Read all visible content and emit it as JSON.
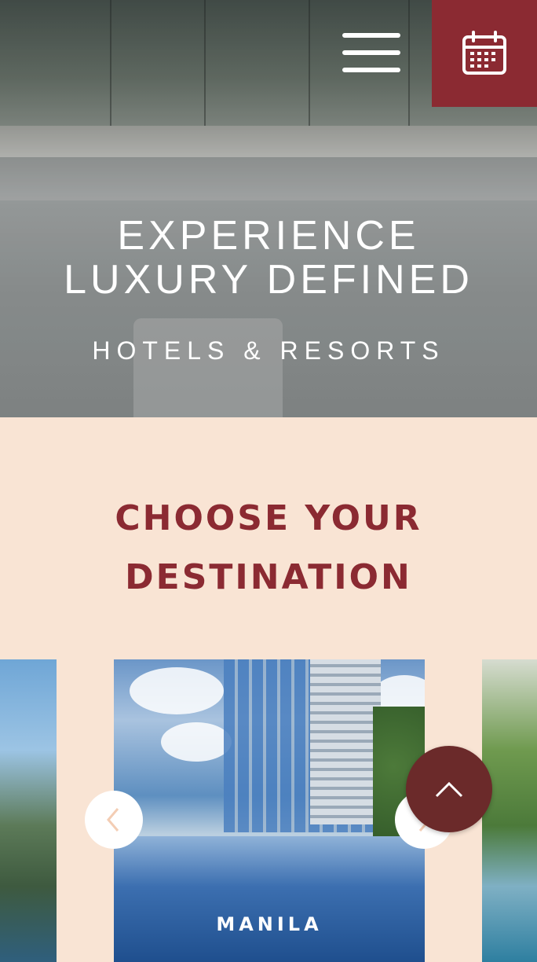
{
  "hero": {
    "title_line1": "EXPERIENCE",
    "title_line2": "LUXURY DEFINED",
    "subtitle": "HOTELS & RESORTS"
  },
  "header": {
    "menu_icon": "hamburger-menu-icon",
    "calendar_icon": "calendar-icon",
    "accent_color": "#8b2a32"
  },
  "destinations": {
    "title_line1": "CHOOSE YOUR",
    "title_line2": "DESTINATION",
    "cards": [
      {
        "caption": ""
      },
      {
        "caption": "MANILA"
      },
      {
        "caption": ""
      }
    ],
    "prev_icon": "chevron-left-icon",
    "next_icon": "chevron-right-icon"
  },
  "scroll_top": {
    "icon": "chevron-up-icon",
    "color": "#6b2a2a"
  },
  "colors": {
    "section_background": "#f9e4d4",
    "title_color": "#8b2a32"
  }
}
